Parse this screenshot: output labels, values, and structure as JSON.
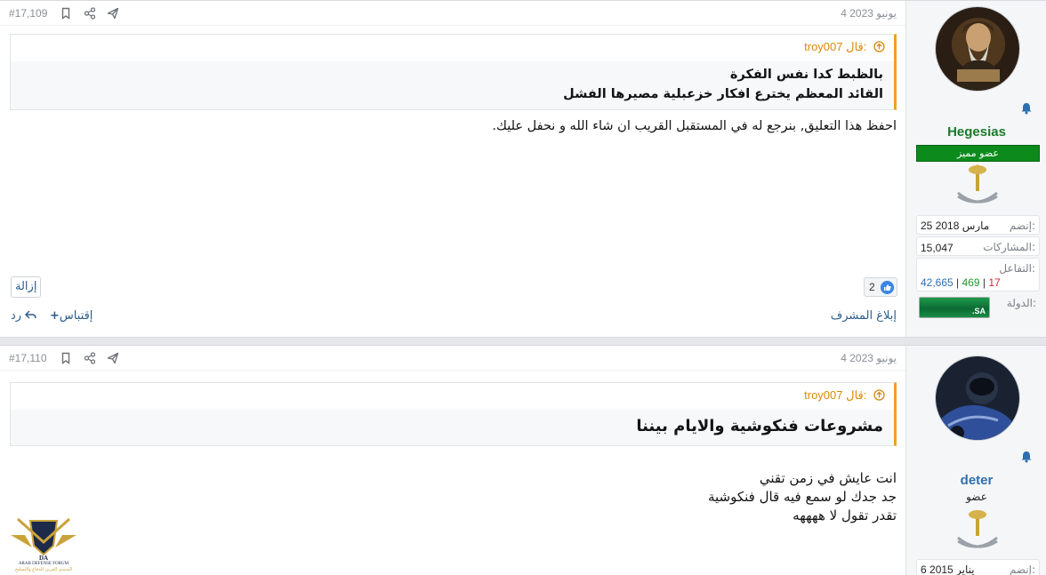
{
  "posts": [
    {
      "number": "#17,109",
      "date": "4 يونيو 2023",
      "user": {
        "name": "Hegesias",
        "role": "عضو مميز",
        "joined_label": "إنضم:",
        "joined_value": "25 مارس 2018",
        "posts_label": "المشاركات:",
        "posts_value": "15,047",
        "reactions_label": "التفاعل:",
        "reactions": [
          "42,665",
          "469",
          "17"
        ],
        "country_label": "الدولة:",
        "country_flag_text": ".SA"
      },
      "quote": {
        "author": "troy007 قال:",
        "lines": [
          "بالظبط كدا نفس الفكرة",
          "القائد المعظم يخترع افكار خزعبلية مصيرها الفشل"
        ]
      },
      "message": [
        "احفظ هذا التعليق, بنرجع له في المستقبل القريب ان شاء الله و نحفل عليك."
      ],
      "reaction_count": "2",
      "remove_label": "إزالة",
      "report_label": "إبلاغ المشرف",
      "quote_action": "إقتباس",
      "reply_action": "رد"
    },
    {
      "number": "#17,110",
      "date": "4 يونيو 2023",
      "user": {
        "name": "deter",
        "role": "عضو",
        "joined_label": "إنضم:",
        "joined_value": "6 يناير 2015"
      },
      "quote": {
        "author": "troy007 قال:",
        "lines": [
          "مشروعات فنكوشية والايام بيننا"
        ]
      },
      "message": [
        "انت عايش في زمن تقني",
        "جد جدك لو سمع فيه قال فنكوشية",
        "تقدر تقول لا ههههه"
      ]
    }
  ],
  "site_logo": {
    "title": "ARAB DEFENSE FORUM",
    "subtitle": "المنتدى العربي للدفاع والتسليح",
    "mark": "DA"
  },
  "colors": {
    "accent_quote": "#f0a024",
    "member_badge": "#0c8a1c",
    "username_green": "#1c7a2b",
    "username_blue": "#2d6fb0",
    "link": "#2d5d8a"
  },
  "icons": [
    "bell-icon",
    "share-icon",
    "bookmark-icon",
    "send-icon",
    "arrow-up-circle-icon",
    "like-icon",
    "plus-icon",
    "reply-icon",
    "emblem-icon"
  ]
}
